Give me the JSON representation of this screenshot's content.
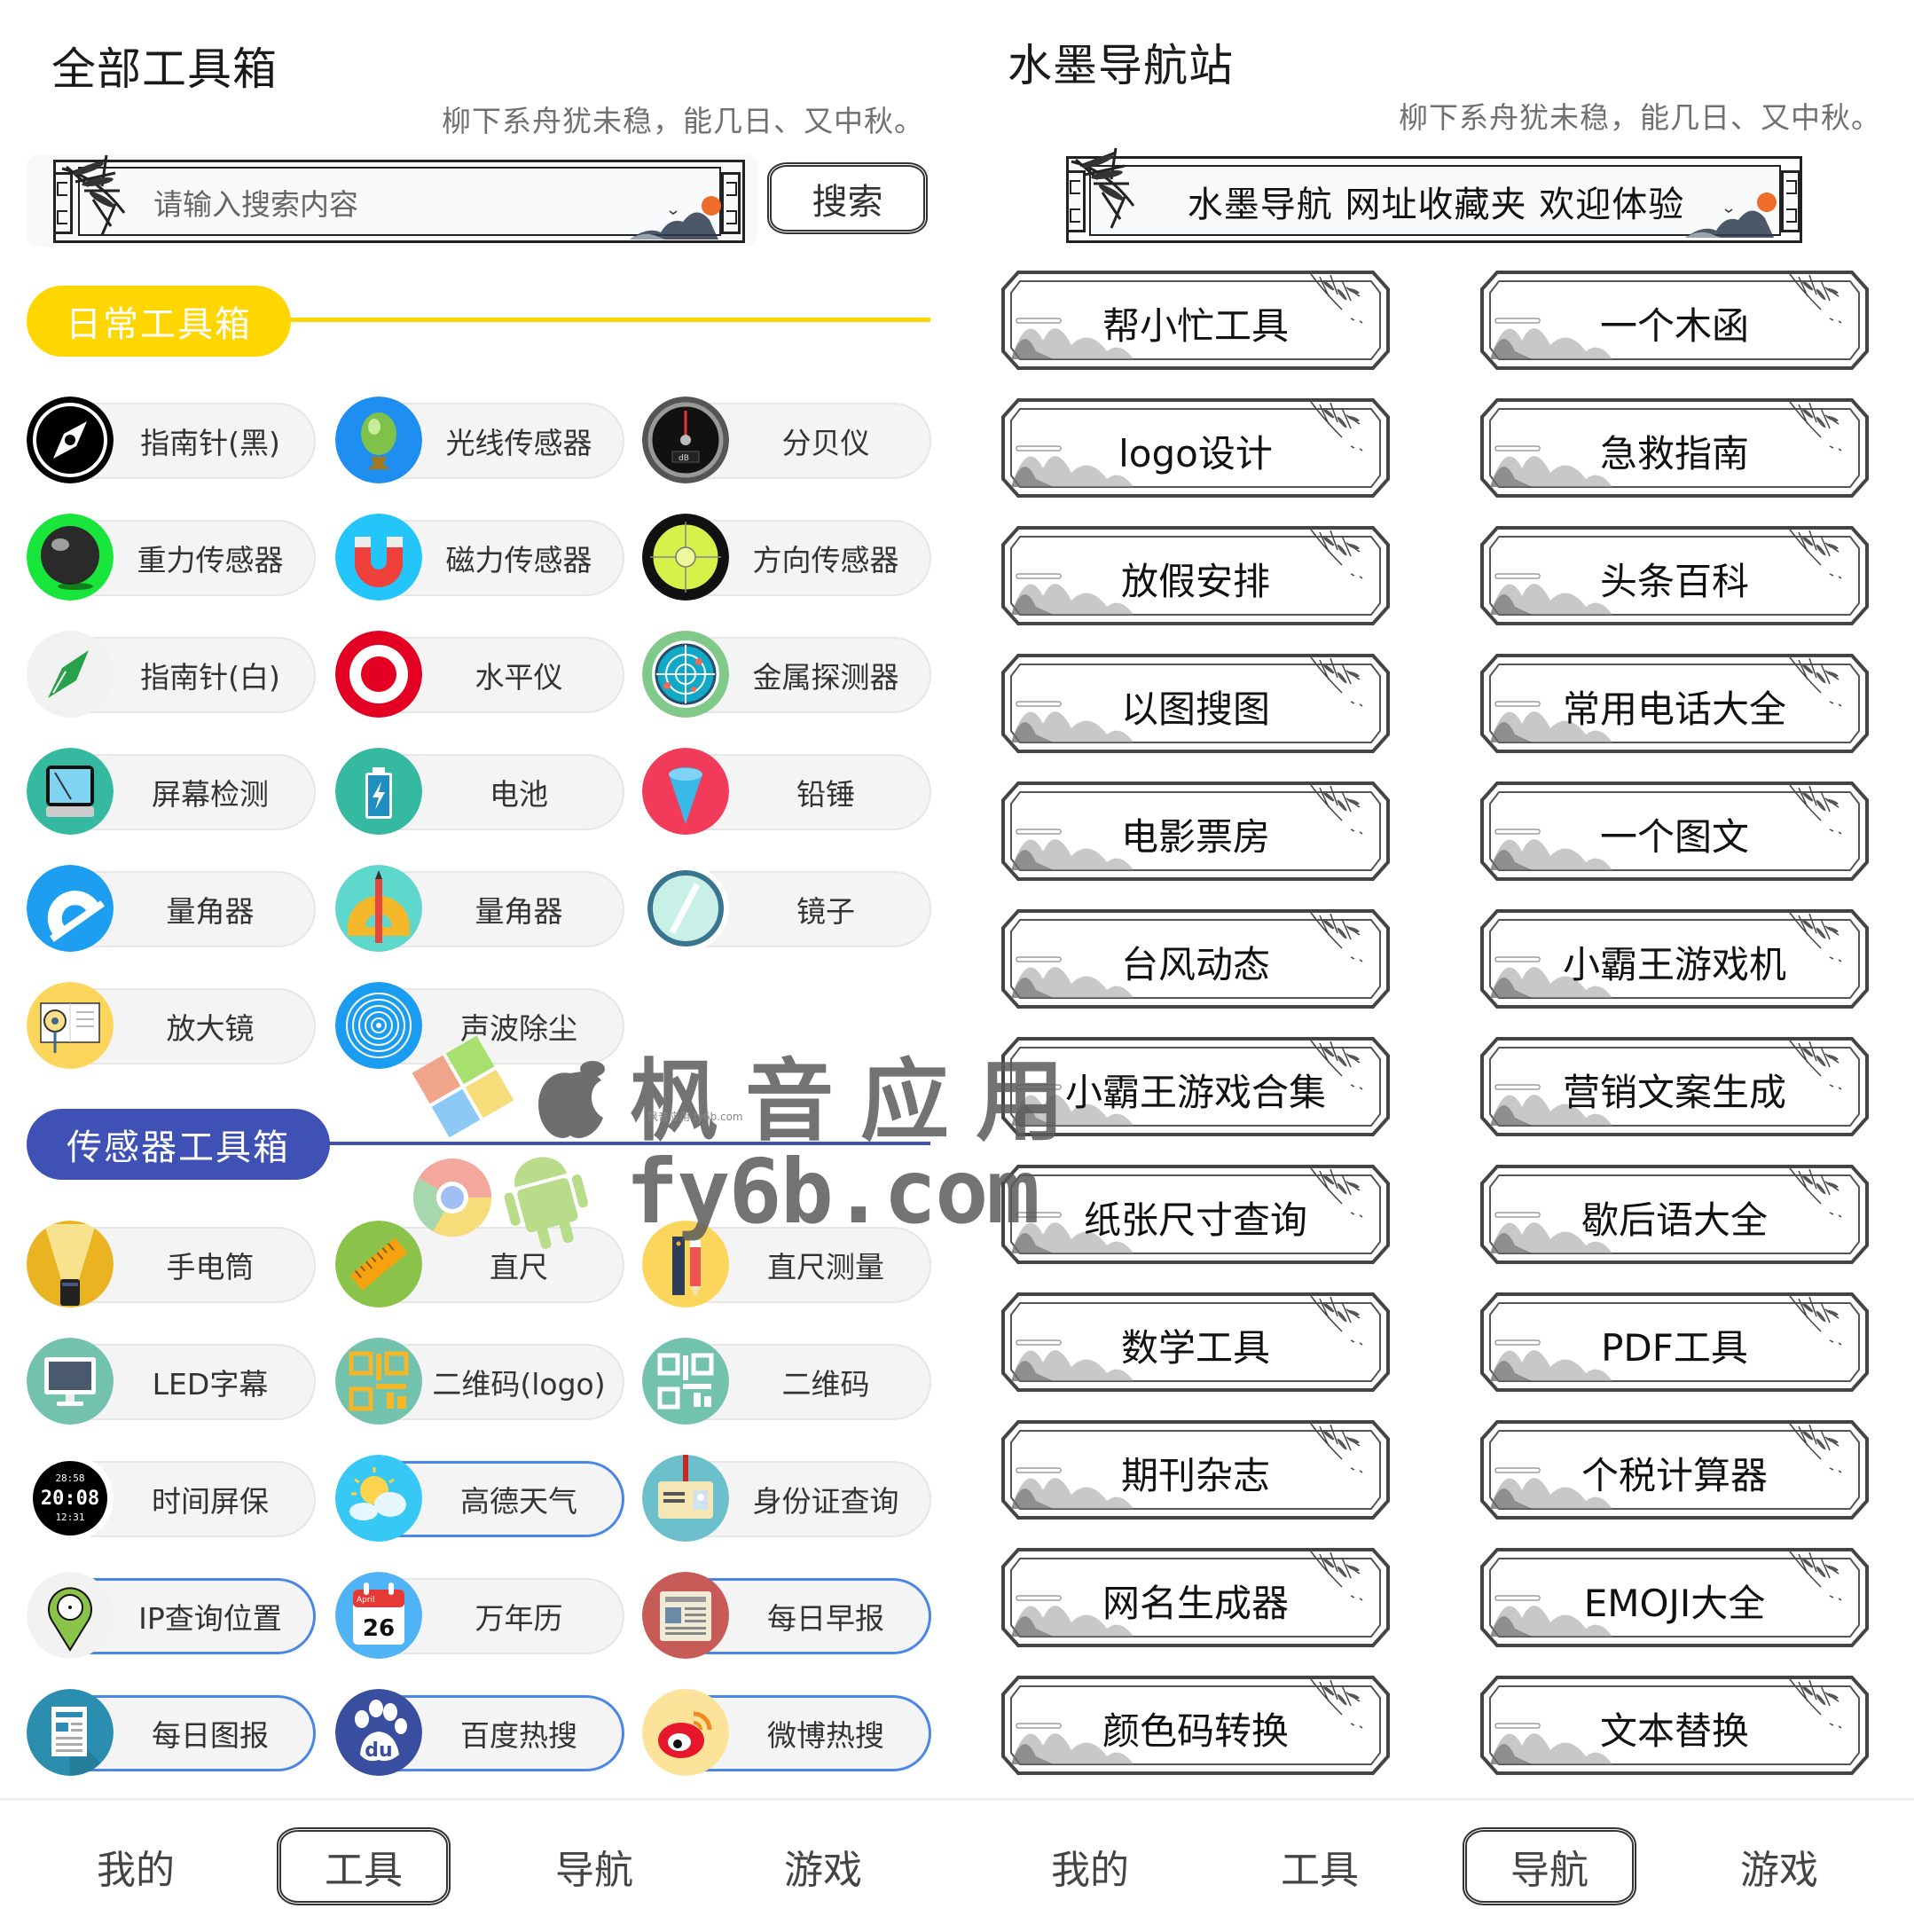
{
  "left": {
    "title": "全部工具箱",
    "subtitle": "柳下系舟犹未稳，能几日、又中秋。",
    "search": {
      "placeholder": "请输入搜索内容",
      "button_label": "搜索"
    },
    "sections": [
      {
        "title": "日常工具箱",
        "color": "#ffd600",
        "tools": [
          {
            "label": "指南针(黑)",
            "icon": "compass-black-icon",
            "highlight": false
          },
          {
            "label": "光线传感器",
            "icon": "crystal-ball-icon",
            "highlight": false
          },
          {
            "label": "分贝仪",
            "icon": "decibel-meter-icon",
            "highlight": false
          },
          {
            "label": "重力传感器",
            "icon": "black-ball-icon",
            "highlight": false
          },
          {
            "label": "磁力传感器",
            "icon": "magnet-icon",
            "highlight": false
          },
          {
            "label": "方向传感器",
            "icon": "bubble-level-icon",
            "highlight": false
          },
          {
            "label": "指南针(白)",
            "icon": "compass-white-icon",
            "highlight": false
          },
          {
            "label": "水平仪",
            "icon": "target-icon",
            "highlight": false
          },
          {
            "label": "金属探测器",
            "icon": "radar-icon",
            "highlight": false
          },
          {
            "label": "屏幕检测",
            "icon": "monitor-icon",
            "highlight": false
          },
          {
            "label": "电池",
            "icon": "battery-icon",
            "highlight": false
          },
          {
            "label": "铅锤",
            "icon": "plumb-bob-icon",
            "highlight": false
          },
          {
            "label": "量角器",
            "icon": "protractor-blue-icon",
            "highlight": false
          },
          {
            "label": "量角器",
            "icon": "protractor-pencil-icon",
            "highlight": false
          },
          {
            "label": "镜子",
            "icon": "mirror-icon",
            "highlight": false
          },
          {
            "label": "放大镜",
            "icon": "magnifier-book-icon",
            "highlight": false
          },
          {
            "label": "声波除尘",
            "icon": "sound-wave-icon",
            "highlight": false
          }
        ]
      },
      {
        "title": "传感器工具箱",
        "color": "#3f51b5",
        "tools": [
          {
            "label": "手电筒",
            "icon": "flashlight-icon",
            "highlight": false
          },
          {
            "label": "直尺",
            "icon": "ruler-icon",
            "highlight": false
          },
          {
            "label": "直尺测量",
            "icon": "ruler-pencil-icon",
            "highlight": false
          },
          {
            "label": "LED字幕",
            "icon": "led-monitor-icon",
            "highlight": false
          },
          {
            "label": "二维码(logo)",
            "icon": "qr-code-orange-icon",
            "highlight": false
          },
          {
            "label": "二维码",
            "icon": "qr-code-white-icon",
            "highlight": false
          },
          {
            "label": "时间屏保",
            "icon": "digital-clock-icon",
            "highlight": false
          },
          {
            "label": "高德天气",
            "icon": "weather-icon",
            "highlight": true
          },
          {
            "label": "身份证查询",
            "icon": "id-card-icon",
            "highlight": false
          },
          {
            "label": "IP查询位置",
            "icon": "location-pin-icon",
            "highlight": true
          },
          {
            "label": "万年历",
            "icon": "calendar-icon",
            "highlight": false
          },
          {
            "label": "每日早报",
            "icon": "newspaper-icon",
            "highlight": true
          },
          {
            "label": "每日图报",
            "icon": "document-icon",
            "highlight": true
          },
          {
            "label": "百度热搜",
            "icon": "baidu-paw-icon",
            "highlight": true
          },
          {
            "label": "微博热搜",
            "icon": "weibo-icon",
            "highlight": true
          }
        ]
      }
    ],
    "calendar_icon": {
      "month": "April",
      "day": "26"
    },
    "clock_icon": {
      "top": "28:58",
      "main": "20:08",
      "bottom": "12:31"
    },
    "decibel_icon_label": "dB",
    "baidu_icon_label": "du",
    "tabbar": {
      "tabs": [
        {
          "label": "我的",
          "active": false
        },
        {
          "label": "工具",
          "active": true
        },
        {
          "label": "导航",
          "active": false
        },
        {
          "label": "游戏",
          "active": false
        }
      ]
    }
  },
  "right": {
    "title": "水墨导航站",
    "subtitle": "柳下系舟犹未稳，能几日、又中秋。",
    "banner": "水墨导航 网址收藏夹 欢迎体验",
    "links": [
      "帮小忙工具",
      "一个木函",
      "logo设计",
      "急救指南",
      "放假安排",
      "头条百科",
      "以图搜图",
      "常用电话大全",
      "电影票房",
      "一个图文",
      "台风动态",
      "小霸王游戏机",
      "小霸王游戏合集",
      "营销文案生成",
      "纸张尺寸查询",
      "歇后语大全",
      "数学工具",
      "PDF工具",
      "期刊杂志",
      "个税计算器",
      "网名生成器",
      "EMOJI大全",
      "颜色码转换",
      "文本替换"
    ],
    "tabbar": {
      "tabs": [
        {
          "label": "我的",
          "active": false
        },
        {
          "label": "工具",
          "active": false
        },
        {
          "label": "导航",
          "active": true
        },
        {
          "label": "游戏",
          "active": false
        }
      ]
    }
  },
  "watermark": {
    "line1": "枫音应用",
    "line2": "fy6b.com",
    "small": "枫音应用 fy6b.com"
  },
  "colors": {
    "daily_section": "#ffd600",
    "sensor_section": "#3f51b5",
    "highlight_border": "#4a86e8",
    "pill_bg": "#f3f4f3"
  }
}
